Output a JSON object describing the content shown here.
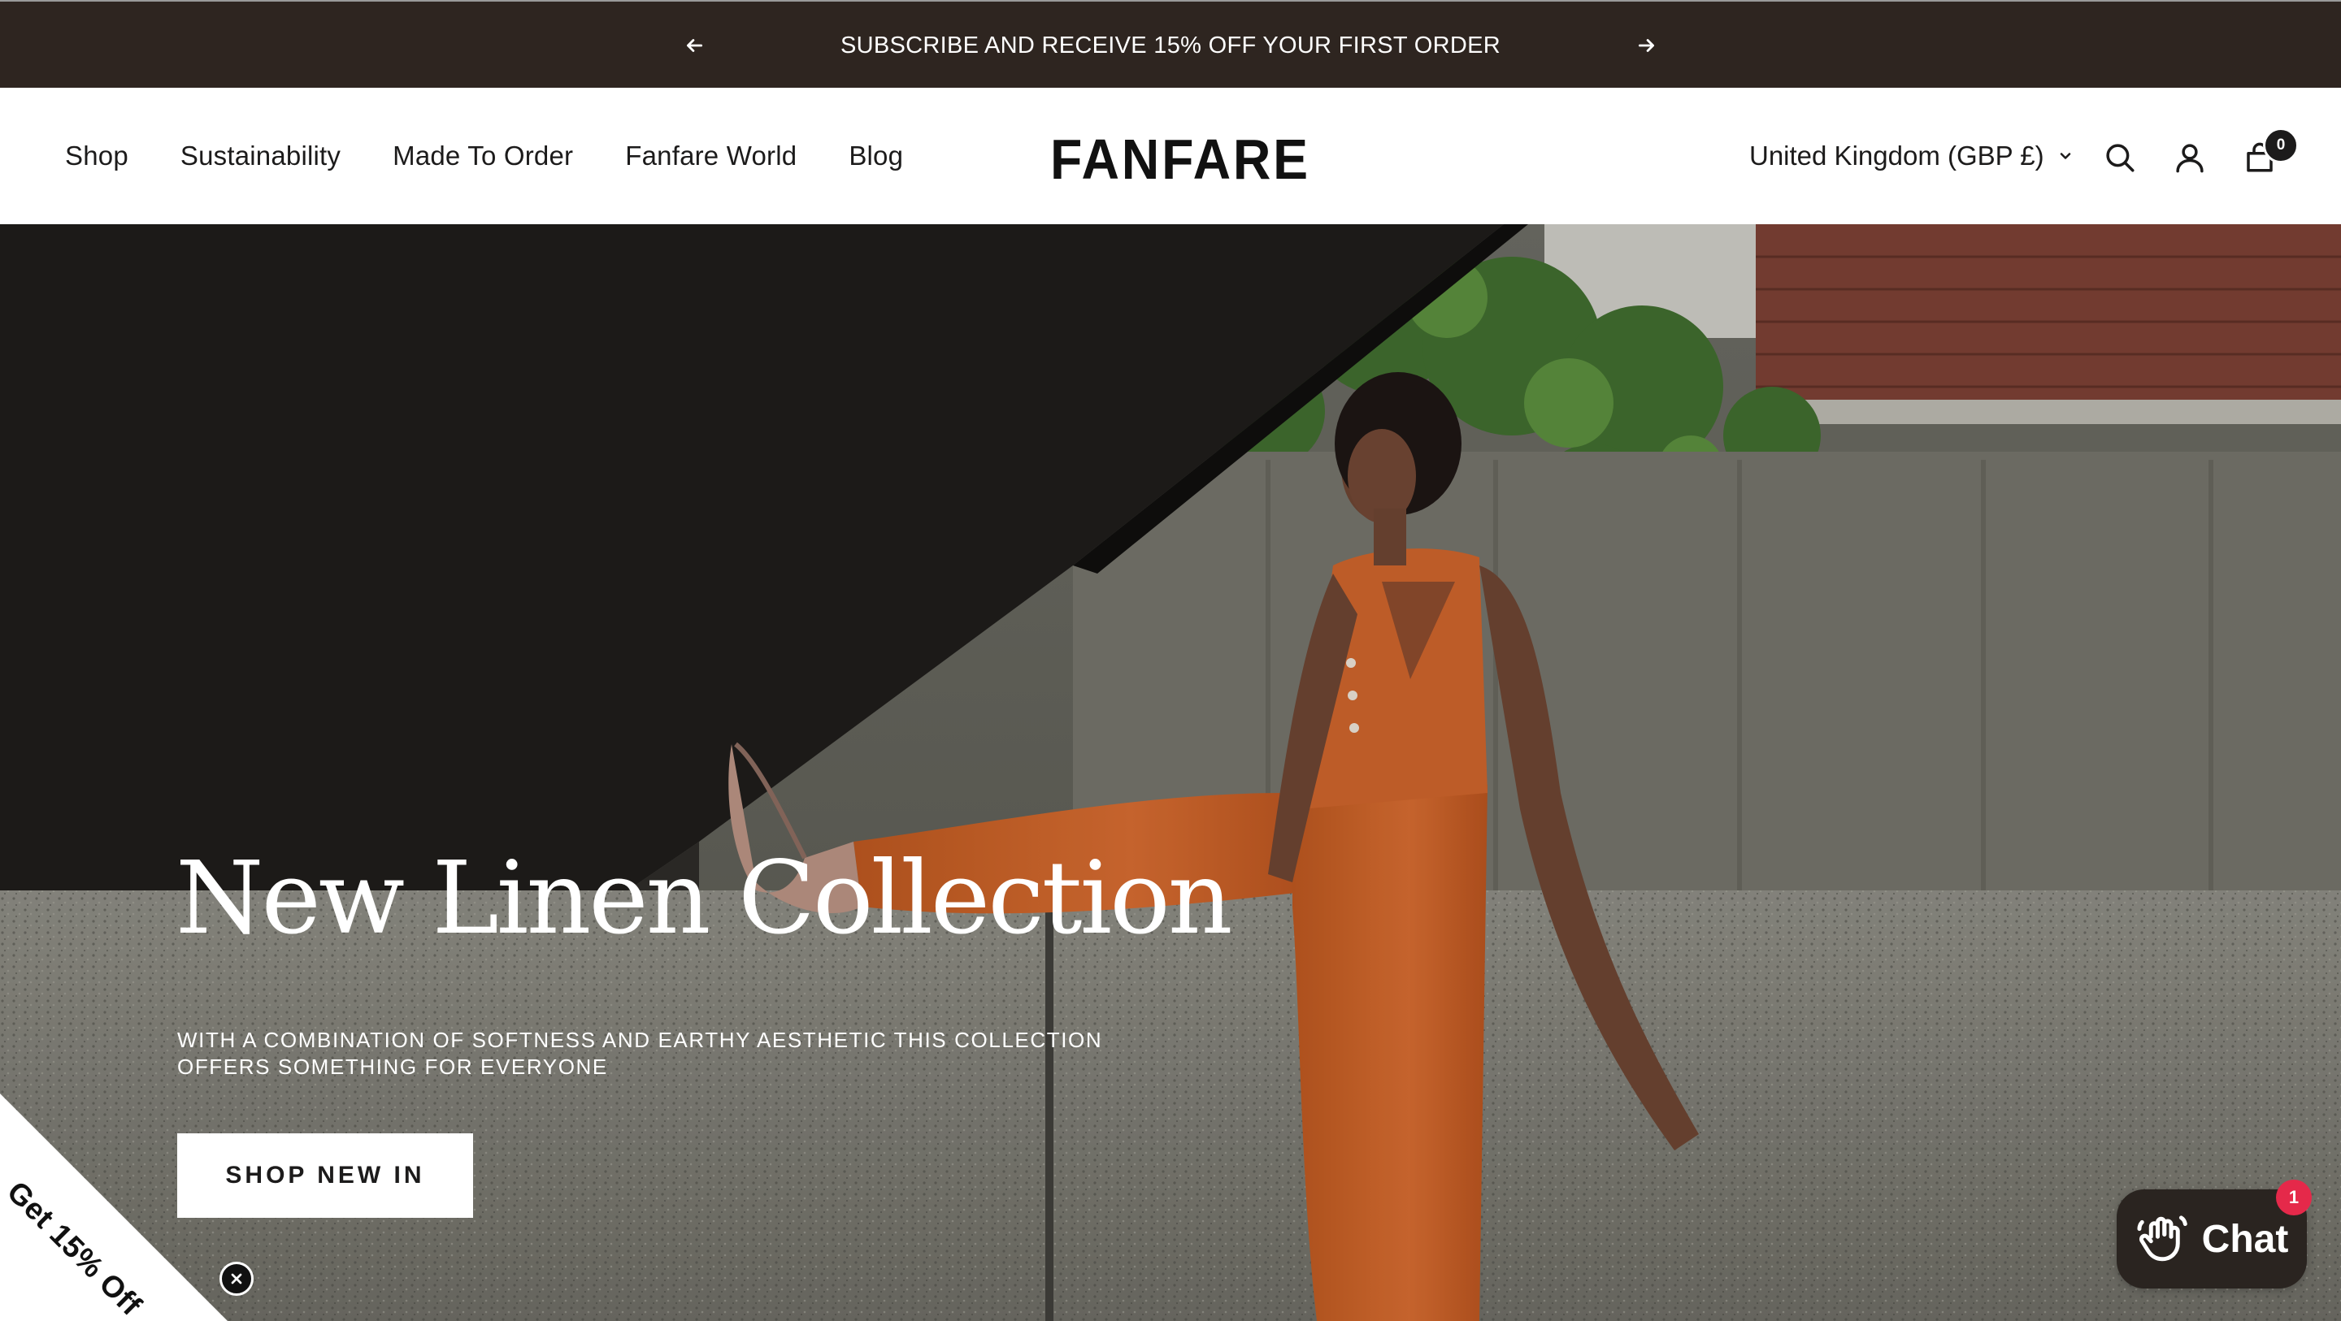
{
  "announcement": {
    "message": "SUBSCRIBE AND RECEIVE 15% OFF YOUR FIRST ORDER",
    "prev_icon": "arrow-left-icon",
    "next_icon": "arrow-right-icon"
  },
  "header": {
    "nav": [
      {
        "label": "Shop"
      },
      {
        "label": "Sustainability"
      },
      {
        "label": "Made To Order"
      },
      {
        "label": "Fanfare World"
      },
      {
        "label": "Blog"
      }
    ],
    "logo": "FANFARE",
    "locale": "United Kingdom (GBP £)",
    "icons": [
      "search-icon",
      "account-icon",
      "cart-icon"
    ],
    "cart_count": "0"
  },
  "hero": {
    "title": "New Linen Collection",
    "text": "WITH A COMBINATION OF SOFTNESS AND EARTHY AESTHETIC THIS COLLECTION OFFERS SOMETHING FOR EVERYONE",
    "button": "SHOP NEW IN"
  },
  "discount_ribbon": {
    "label": "Get 15% Off",
    "close_icon": "close-icon"
  },
  "chat": {
    "label": "Chat",
    "badge": "1",
    "icon": "waving-hand-icon"
  },
  "colors": {
    "announcement_bg": "#2e2520",
    "text": "#1c1b1b",
    "outfit_orange": "#c7602a",
    "chat_bg": "#2a2420",
    "chat_badge": "#e5294a"
  }
}
